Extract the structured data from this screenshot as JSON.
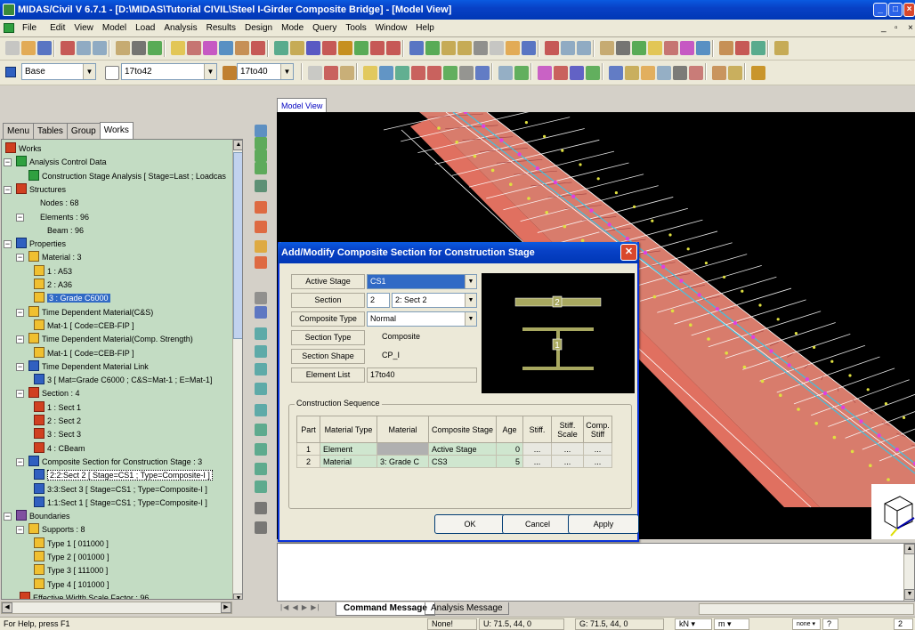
{
  "window": {
    "title": "MIDAS/Civil V 6.7.1 - [D:\\MIDAS\\Tutorial CIVIL\\Steel I-Girder Composite Bridge] - [Model View]"
  },
  "menu": [
    "File",
    "Edit",
    "View",
    "Model",
    "Load",
    "Analysis",
    "Results",
    "Design",
    "Mode",
    "Query",
    "Tools",
    "Window",
    "Help"
  ],
  "toolbar": {
    "coord_system": "Base",
    "element_select": "17to42",
    "node_select": "17to40"
  },
  "left_panel": {
    "tabs": [
      "Menu",
      "Tables",
      "Group",
      "Works"
    ],
    "tree": [
      "Works",
      "Analysis Control Data",
      "Construction Stage Analysis [ Stage=Last ; Loadcas",
      "Structures",
      "Nodes : 68",
      "Elements : 96",
      "Beam : 96",
      "Properties",
      "Material : 3",
      "1 : A53",
      "2 : A36",
      "3 : Grade C6000",
      "Time Dependent Material(C&S)",
      "Mat-1 [ Code=CEB-FIP ]",
      "Time Dependent Material(Comp. Strength)",
      "Mat-1 [ Code=CEB-FIP ]",
      "Time Dependent Material Link",
      "3 [ Mat=Grade C6000 ; C&S=Mat-1 ; E=Mat-1]",
      "Section : 4",
      "1 : Sect 1",
      "2 : Sect 2",
      "3 : Sect 3",
      "4 : CBeam",
      "Composite Section for Construction Stage : 3",
      "2:2:Sect 2 [ Stage=CS1 ; Type=Composite-I ]",
      "3:3:Sect 3 [ Stage=CS1 ; Type=Composite-I ]",
      "1:1:Sect 1 [ Stage=CS1 ; Type=Composite-I ]",
      "Boundaries",
      "Supports : 8",
      "Type 1 [ 011000 ]",
      "Type 2 [ 001000 ]",
      "Type 3 [ 111000 ]",
      "Type 4 [ 101000 ]",
      "Effective Width Scale Factor : 96"
    ]
  },
  "view_tab": "Model View",
  "dialog": {
    "title": "Add/Modify Composite Section for Construction Stage",
    "active_stage_label": "Active Stage",
    "active_stage": "CS1",
    "section_label": "Section",
    "section_num": "2",
    "section_name": "2: Sect 2",
    "composite_type_label": "Composite Type",
    "composite_type": "Normal",
    "section_type_label": "Section Type",
    "section_type": "Composite",
    "section_shape_label": "Section Shape",
    "section_shape": "CP_I",
    "element_list_label": "Element List",
    "element_list": "17to40",
    "preview_labels": [
      "2",
      "1"
    ],
    "group_title": "Construction Sequence",
    "table": {
      "headers": [
        "Part",
        "Material Type",
        "Material",
        "Composite Stage",
        "Age",
        "Stiff.",
        "Stiff. Scale",
        "Comp. Stiff"
      ],
      "rows": [
        {
          "n": "1",
          "part": "Element",
          "material": "",
          "stage": "Active Stage",
          "age": "0",
          "a": "...",
          "b": "...",
          "c": "..."
        },
        {
          "n": "2",
          "part": "Material",
          "material": "3: Grade C",
          "stage": "CS3",
          "age": "5",
          "a": "...",
          "b": "...",
          "c": "..."
        }
      ]
    },
    "buttons": {
      "ok": "OK",
      "cancel": "Cancel",
      "apply": "Apply"
    }
  },
  "bottom_tabs": [
    "Command Message",
    "Analysis Message"
  ],
  "status": {
    "help": "For Help, press F1",
    "none": "None!",
    "u": "U: 71.5, 44, 0",
    "g": "G: 71.5, 44, 0",
    "force": "kN",
    "length": "m",
    "none2": "none",
    "n1": "2"
  },
  "colors": {
    "title_blue": "#0841c6",
    "tree_bg": "#c3dcc3",
    "girder": "#f08a78",
    "table_row": "#cfe6cf"
  }
}
